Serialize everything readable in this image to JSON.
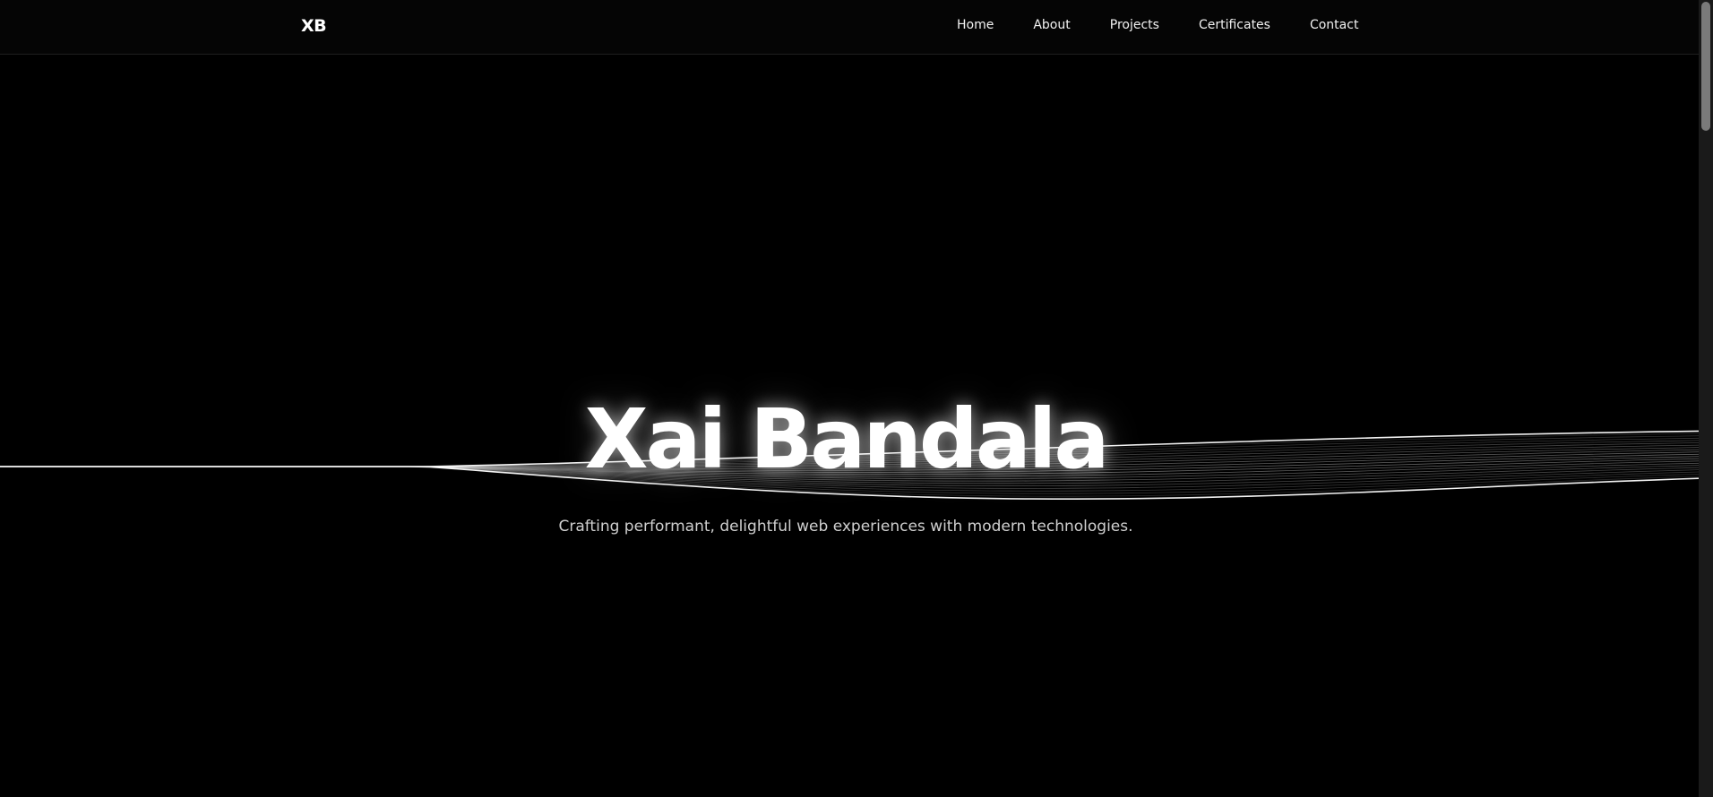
{
  "nav": {
    "logo": "XB",
    "links": [
      "Home",
      "About",
      "Projects",
      "Certificates",
      "Contact"
    ]
  },
  "hero": {
    "title": "Xai Bandala",
    "subtitle": "Crafting performant, delightful web experiences with modern technologies."
  },
  "colors": {
    "background": "#000000",
    "text": "#ffffff",
    "subtitle": "#cfcfcf",
    "wave": "#ffffff"
  }
}
